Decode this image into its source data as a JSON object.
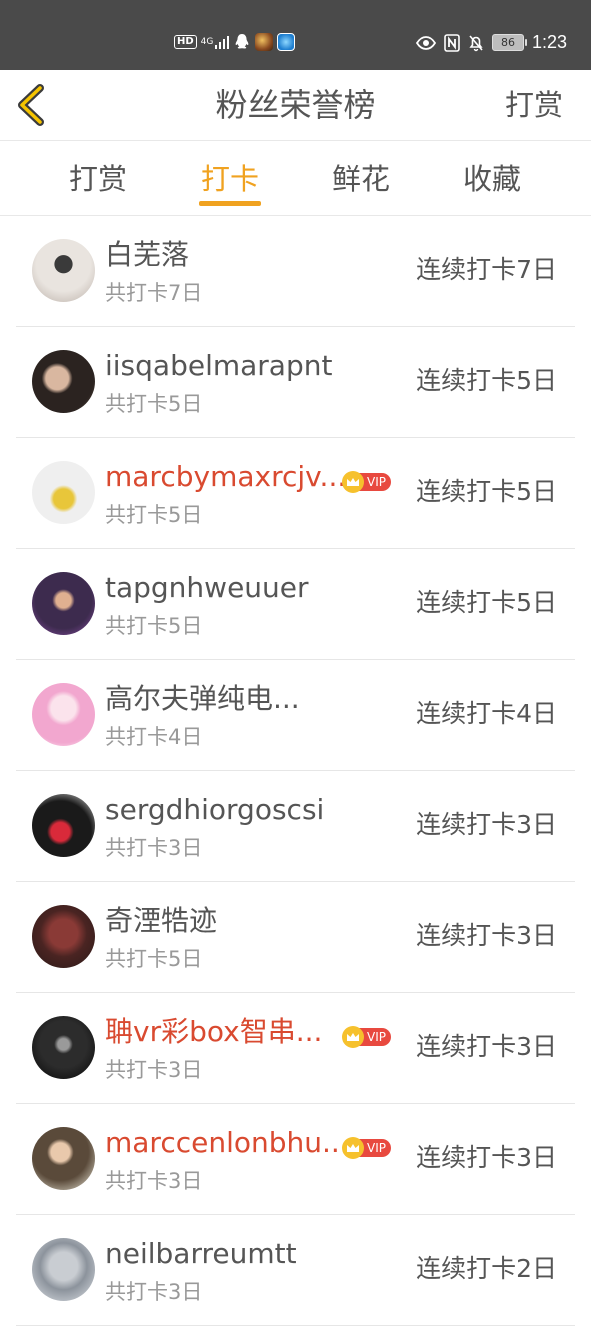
{
  "status_bar": {
    "hd": "HD",
    "network": "4G",
    "time": "1:23",
    "battery": "86",
    "nfc": "N"
  },
  "header": {
    "title": "粉丝荣誉榜",
    "action": "打赏"
  },
  "tabs": [
    {
      "label": "打赏",
      "active": false
    },
    {
      "label": "打卡",
      "active": true
    },
    {
      "label": "鲜花",
      "active": false
    },
    {
      "label": "收藏",
      "active": false
    }
  ],
  "vip_label": "VIP",
  "colors": {
    "accent": "#f0a220",
    "vip_name": "#d94a30",
    "vip_badge": "#e8493f",
    "crown": "#f6c12d"
  },
  "rows": [
    {
      "name": "白芜落",
      "total": "共打卡7日",
      "streak": "连续打卡7日",
      "vip": false
    },
    {
      "name": "iisqabelmarapnt",
      "total": "共打卡5日",
      "streak": "连续打卡5日",
      "vip": false
    },
    {
      "name": "marcbymaxrcjv...",
      "total": "共打卡5日",
      "streak": "连续打卡5日",
      "vip": true
    },
    {
      "name": "tapgnhweuuer",
      "total": "共打卡5日",
      "streak": "连续打卡5日",
      "vip": false
    },
    {
      "name": "高尔夫弹纯电...",
      "total": "共打卡4日",
      "streak": "连续打卡4日",
      "vip": false
    },
    {
      "name": "sergdhiorgoscsi",
      "total": "共打卡3日",
      "streak": "连续打卡3日",
      "vip": false
    },
    {
      "name": "奇湮牿迹",
      "total": "共打卡5日",
      "streak": "连续打卡3日",
      "vip": false
    },
    {
      "name": "聃vr彩box智串...",
      "total": "共打卡3日",
      "streak": "连续打卡3日",
      "vip": true
    },
    {
      "name": "marccenlonbhu...",
      "total": "共打卡3日",
      "streak": "连续打卡3日",
      "vip": true
    },
    {
      "name": "neilbarreumtt",
      "total": "共打卡3日",
      "streak": "连续打卡2日",
      "vip": false
    }
  ]
}
